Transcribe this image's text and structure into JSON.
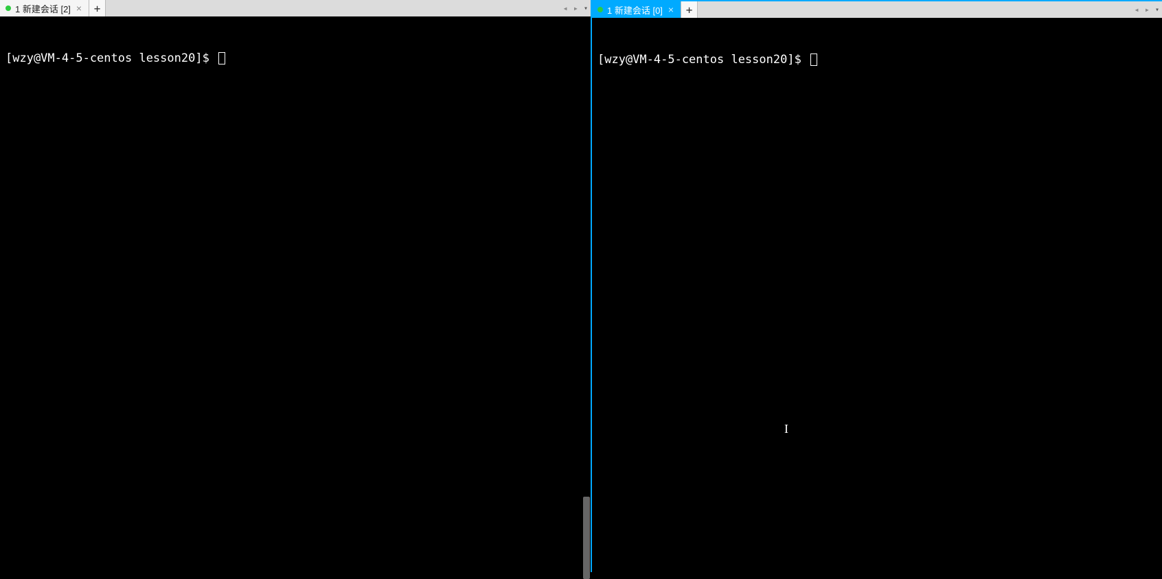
{
  "panes": {
    "left": {
      "tab": {
        "label": "1 新建会话 [2]",
        "dot_color": "green",
        "active_style": "light"
      },
      "add_label": "+",
      "nav": {
        "left": "◂",
        "right": "▸",
        "dropdown": "▾"
      },
      "prompt": "[wzy@VM-4-5-centos lesson20]$ "
    },
    "right": {
      "tab": {
        "label": "1 新建会话 [0]",
        "dot_color": "green",
        "active_style": "blue"
      },
      "add_label": "+",
      "nav": {
        "left": "◂",
        "right": "▸",
        "dropdown": "▾"
      },
      "prompt": "[wzy@VM-4-5-centos lesson20]$ ",
      "cursor_beam": "I"
    }
  }
}
